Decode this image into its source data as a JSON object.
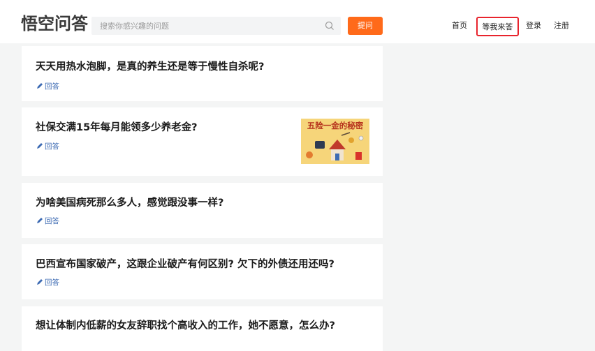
{
  "header": {
    "logo": "悟空问答",
    "search_placeholder": "搜索你感兴趣的问题",
    "ask_button": "提问",
    "nav": {
      "home": "首页",
      "wait_answer": "等我来答",
      "login": "登录",
      "register": "注册"
    }
  },
  "feed": {
    "items": [
      {
        "title": "天天用热水泡脚，是真的养生还是等于慢性自杀呢?",
        "answer": "回答"
      },
      {
        "title": "社保交满15年每月能领多少养老金?",
        "answer": "回答",
        "thumbnail_text": "五险一金的秘密"
      },
      {
        "title": "为啥美国病死那么多人，感觉跟没事一样?",
        "answer": "回答"
      },
      {
        "title": "巴西宣布国家破产，这跟企业破产有何区别? 欠下的外债还用还吗?",
        "answer": "回答"
      },
      {
        "title": "想让体制内低薪的女友辞职找个高收入的工作，她不愿意，怎么办?"
      }
    ]
  },
  "colors": {
    "accent": "#ff6a1a",
    "link": "#3d6bb3",
    "highlight_border": "#e8242d"
  }
}
